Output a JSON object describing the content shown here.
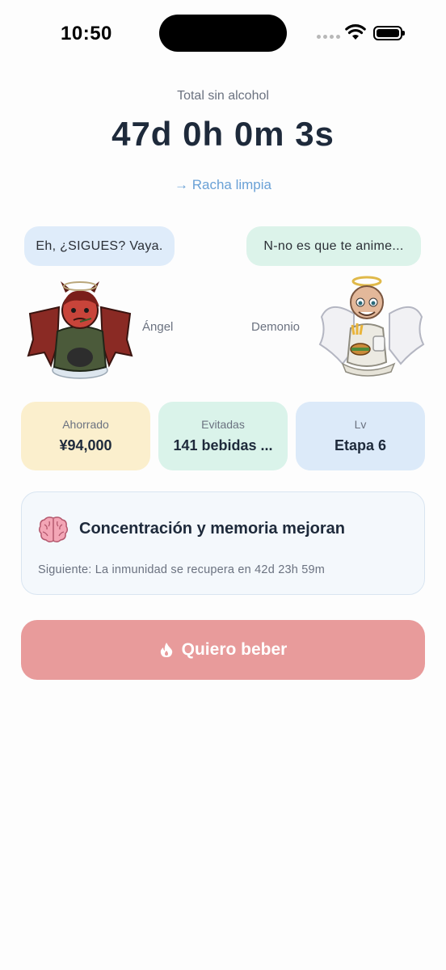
{
  "status_bar": {
    "time": "10:50"
  },
  "header": {
    "total_label": "Total sin alcohol",
    "total_value": "47d 0h 0m 3s",
    "streak_link": "→ Racha limpia"
  },
  "characters": {
    "left": {
      "bubble": "Eh, ¿SIGUES? Vaya.",
      "label": "Ángel",
      "icon": "devil-character-icon"
    },
    "right": {
      "bubble": "N-no es que te anime...",
      "label": "Demonio",
      "icon": "angel-character-icon"
    }
  },
  "stats": [
    {
      "label": "Ahorrado",
      "value": "¥94,000",
      "color": "#fbefcd"
    },
    {
      "label": "Evitadas",
      "value": "141 bebidas ...",
      "color": "#daf3ea"
    },
    {
      "label": "Lv",
      "value": "Etapa 6",
      "color": "#dceaf9"
    }
  ],
  "milestone": {
    "icon": "brain-icon",
    "title": "Concentración y memoria mejoran",
    "next": "Siguiente: La inmunidad se recupera en 42d 23h 59m"
  },
  "cta": {
    "label": "Quiero beber",
    "icon": "flame-icon",
    "color": "#e89b9b"
  }
}
